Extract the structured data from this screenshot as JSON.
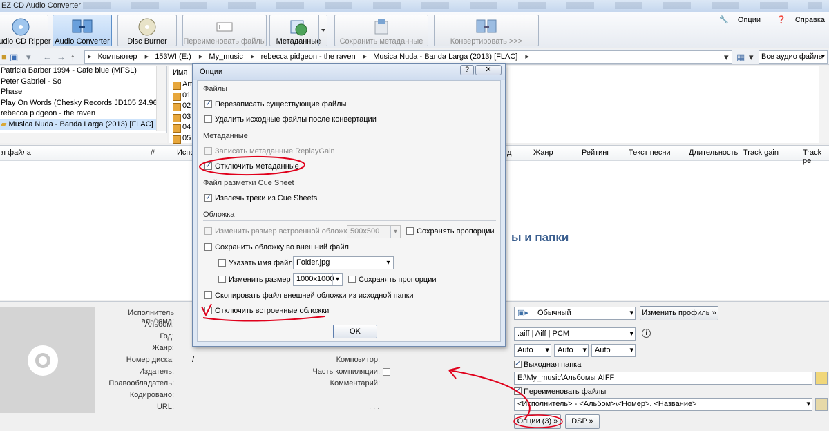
{
  "window": {
    "title": "EZ CD Audio Converter"
  },
  "ribbon": {
    "buttons": [
      {
        "label": "Audio CD Ripper",
        "state": "normal",
        "icon": "cd-ripper-icon"
      },
      {
        "label": "Audio Converter",
        "state": "active",
        "icon": "music-notes-icon"
      },
      {
        "label": "Disc Burner",
        "state": "normal",
        "icon": "disc-icon"
      },
      {
        "label": "Переименовать файлы",
        "state": "disabled",
        "icon": "rename-icon"
      },
      {
        "label": "Метаданные",
        "state": "normal",
        "icon": "metadata-globe-icon"
      },
      {
        "label": "Сохранить метаданные",
        "state": "disabled",
        "icon": "save-metadata-icon"
      },
      {
        "label": "Конвертировать >>>",
        "state": "disabled",
        "icon": "convert-icon"
      }
    ],
    "options_link": "Опции",
    "help_link": "Справка"
  },
  "address": {
    "path": [
      "Компьютер",
      "153WI (E:)",
      "My_music",
      "rebecca pidgeon - the raven",
      "Musica Nuda - Banda Larga (2013) [FLAC]"
    ],
    "filter": "Все аудио файлы"
  },
  "tree": {
    "items": [
      "Patricia Barber 1994 - Cafe blue (MFSL)",
      "Peter Gabriel - So",
      "Phase",
      "Play On Words (Chesky Records JD105 24.96)",
      "rebecca pidgeon - the raven",
      "Musica Nuda - Banda Larga (2013) [FLAC]"
    ],
    "selected_index": 5
  },
  "files": {
    "header": "Имя",
    "rows": [
      "Artw",
      "01 -",
      "02 -",
      "03 -",
      "04 -",
      "05 -"
    ]
  },
  "tracklist": {
    "columns": [
      "я файла",
      "#",
      "Испол",
      "д",
      "Жанр",
      "Рейтинг",
      "Текст песни",
      "Длительность",
      "Track gain",
      "Track pe"
    ],
    "drop_hint": "ы и папки"
  },
  "metadata": {
    "left_labels": [
      "Исполнитель альбома:",
      "Альбом:",
      "Год:",
      "Жанр:",
      "Номер диска:",
      "Издатель:",
      "Правообладатель:",
      "Кодировано:",
      "URL:"
    ],
    "disc_separator": "/",
    "right_labels": [
      "Композитор:",
      "Часть компиляции:",
      "Комментарий:"
    ],
    "dots": ". . ."
  },
  "profile": {
    "profile_value": "Обычный",
    "change_profile": "Изменить профиль »",
    "format": ".aiff | Aiff | PCM",
    "auto1": "Auto",
    "auto2": "Auto",
    "auto3": "Auto",
    "output_folder_label": "Выходная папка",
    "output_folder_value": "E:\\My_music\\Альбомы AIFF",
    "rename_files_label": "Переименовать файлы",
    "rename_pattern": "<Исполнитель> - <Альбом>\\<Номер>. <Название>",
    "options_button": "Опции (3) »",
    "dsp_button": "DSP »"
  },
  "dialog": {
    "title": "Опции",
    "help_btn": "?",
    "close_btn": "✕",
    "sections": {
      "files": "Файлы",
      "metadata": "Метаданные",
      "cue": "Файл разметки Cue Sheet",
      "cover": "Обложка"
    },
    "options": {
      "overwrite": "Перезаписать существующие файлы",
      "delete_source": "Удалить исходные файлы после конвертации",
      "replaygain": "Записать метаданные ReplayGain",
      "disable_metadata": "Отключить метаданные",
      "extract_cue": "Извлечь треки из Cue Sheets",
      "resize_embedded": "Изменить размер встроенной обложки",
      "resize_embedded_value": "500x500",
      "keep_aspect1": "Сохранять пропорции",
      "save_external": "Сохранить обложку во внешний файл",
      "filename_label": "Указать имя файла",
      "filename_value": "Folder.jpg",
      "resize_label": "Изменить размер",
      "resize_value": "1000x1000",
      "keep_aspect2": "Сохранять пропорции",
      "copy_external": "Скопировать файл внешней обложки из исходной папки",
      "disable_embedded": "Отключить встроенные обложки"
    },
    "ok": "OK"
  },
  "colors": {
    "annotation": "#e0001b",
    "accent": "#3b5f8f"
  }
}
